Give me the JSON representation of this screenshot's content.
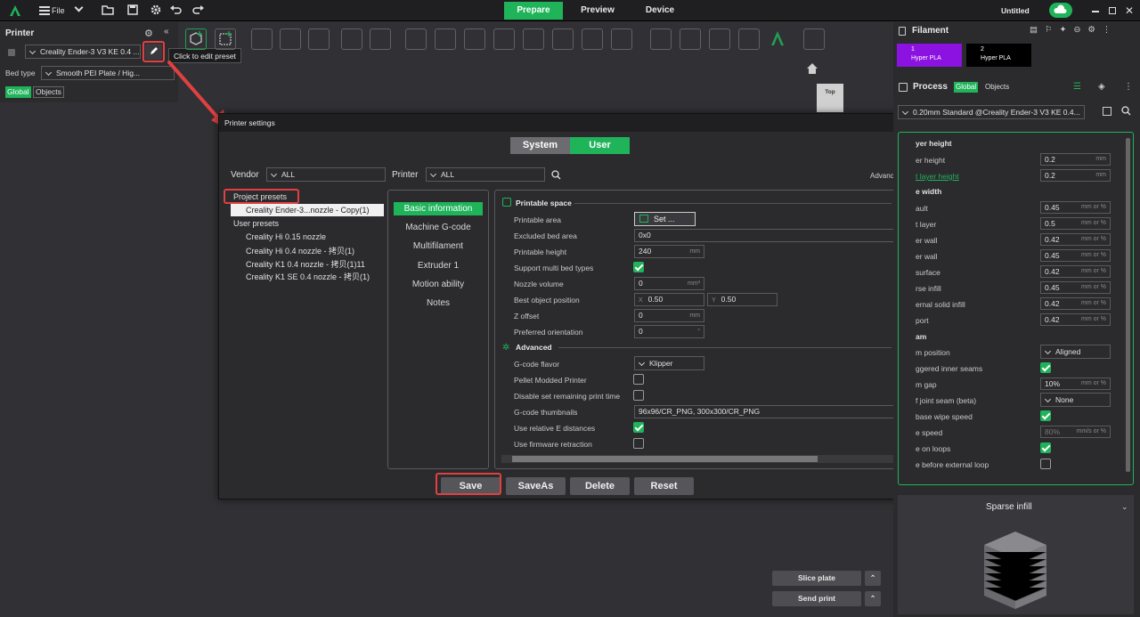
{
  "topbar": {
    "file_label": "File",
    "tabs": [
      "Prepare",
      "Preview",
      "Device"
    ],
    "doc_title": "Untitled"
  },
  "left": {
    "printer_title": "Printer",
    "printer_preset": "Creality Ender-3 V3 KE 0.4 ...",
    "tooltip": "Click to edit preset",
    "bed_type_label": "Bed type",
    "bed_type_value": "Smooth PEI Plate / Hig...",
    "global_label": "Global",
    "objects_label": "Objects"
  },
  "viewport": {
    "cube_label": "Top"
  },
  "dialog": {
    "title": "Printer settings",
    "system_label": "System",
    "user_label": "User",
    "vendor_label": "Vendor",
    "vendor_value": "ALL",
    "printer_label": "Printer",
    "printer_value": "ALL",
    "advanced_label": "Advanced",
    "project_presets_label": "Project presets",
    "project_preset_item": "Creality Ender-3...nozzle - Copy(1)",
    "user_presets_label": "User presets",
    "user_presets": [
      "Creality Hi 0.15 nozzle",
      "Creality Hi 0.4 nozzle - 拷贝(1)",
      "Creality K1 0.4 nozzle - 拷贝(1)11",
      "Creality K1 SE 0.4 nozzle - 拷贝(1)"
    ],
    "nav": [
      "Basic information",
      "Machine G-code",
      "Multifilament",
      "Extruder 1",
      "Motion ability",
      "Notes"
    ],
    "printable_space_title": "Printable space",
    "rows1": [
      {
        "label": "Printable area",
        "value": "Set ...",
        "unit": ""
      },
      {
        "label": "Excluded bed area",
        "value": "0x0",
        "unit": ""
      },
      {
        "label": "Printable height",
        "value": "240",
        "unit": "mm"
      },
      {
        "label": "Support multi bed types",
        "value": "",
        "unit": ""
      },
      {
        "label": "Nozzle volume",
        "value": "0",
        "unit": "mm³"
      },
      {
        "label": "Best object position",
        "value": "0.50",
        "value2": "0.50",
        "unit": "",
        "x_label": "X",
        "y_label": "Y"
      },
      {
        "label": "Z offset",
        "value": "0",
        "unit": "mm"
      },
      {
        "label": "Preferred orientation",
        "value": "0",
        "unit": "°"
      }
    ],
    "advanced_title": "Advanced",
    "rows2": [
      {
        "label": "G-code flavor",
        "value": "Klipper"
      },
      {
        "label": "Pellet Modded Printer",
        "value": ""
      },
      {
        "label": "Disable set remaining print time",
        "value": ""
      },
      {
        "label": "G-code thumbnails",
        "value": "96x96/CR_PNG, 300x300/CR_PNG"
      },
      {
        "label": "Use relative E distances",
        "value": ""
      },
      {
        "label": "Use firmware retraction",
        "value": ""
      }
    ],
    "buttons": [
      "Save",
      "SaveAs",
      "Delete",
      "Reset"
    ]
  },
  "right": {
    "filament_title": "Filament",
    "filaments": [
      {
        "num": "1",
        "name": "Hyper PLA",
        "color": "#8b12e0"
      },
      {
        "num": "2",
        "name": "Hyper PLA",
        "color": "#000000"
      }
    ],
    "process_title": "Process",
    "global_label": "Global",
    "objects_label": "Objects",
    "process_preset": "0.20mm Standard @Creality Ender-3 V3 KE 0.4...",
    "sections": [
      {
        "title": "yer height",
        "rows": [
          {
            "label": "er height",
            "value": "0.2",
            "unit": "mm"
          },
          {
            "label": "t layer height",
            "value": "0.2",
            "unit": "mm",
            "highlight": true
          }
        ]
      },
      {
        "title": "e width",
        "rows": [
          {
            "label": "ault",
            "value": "0.45",
            "unit": "mm or %"
          },
          {
            "label": "t layer",
            "value": "0.5",
            "unit": "mm or %"
          },
          {
            "label": "er wall",
            "value": "0.42",
            "unit": "mm or %"
          },
          {
            "label": "er wall",
            "value": "0.45",
            "unit": "mm or %"
          },
          {
            "label": "surface",
            "value": "0.42",
            "unit": "mm or %"
          },
          {
            "label": "rse infill",
            "value": "0.45",
            "unit": "mm or %"
          },
          {
            "label": "ernal solid infill",
            "value": "0.42",
            "unit": "mm or %"
          },
          {
            "label": "port",
            "value": "0.42",
            "unit": "mm or %"
          }
        ]
      },
      {
        "title": "am",
        "rows": [
          {
            "label": "m position",
            "value": "Aligned",
            "unit": "",
            "type": "select"
          },
          {
            "label": "ggered inner seams",
            "value": "",
            "unit": "",
            "type": "check"
          },
          {
            "label": "m gap",
            "value": "10%",
            "unit": "mm or %"
          },
          {
            "label": "f joint seam (beta)",
            "value": "None",
            "unit": "",
            "type": "select"
          },
          {
            "label": "base wipe speed",
            "value": "",
            "unit": "",
            "type": "check"
          },
          {
            "label": "e speed",
            "value": "80%",
            "unit": "mm/s or %",
            "dim": true
          },
          {
            "label": "e on loops",
            "value": "",
            "unit": "",
            "type": "check"
          },
          {
            "label": "e before external loop",
            "value": "",
            "unit": "",
            "type": "check-off"
          }
        ]
      }
    ],
    "sparse_infill_label": "Sparse infill"
  },
  "bottom": {
    "slice_label": "Slice plate",
    "send_label": "Send print"
  }
}
